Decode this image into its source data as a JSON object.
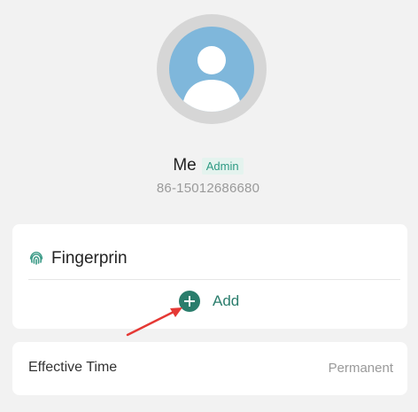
{
  "profile": {
    "name": "Me",
    "role_badge": "Admin",
    "phone": "86-15012686680"
  },
  "fingerprint": {
    "title": "Fingerprin",
    "icon": "fingerprint-icon",
    "add_label": "Add",
    "add_icon": "plus-circle-icon"
  },
  "effective_time": {
    "label": "Effective Time",
    "value": "Permanent"
  },
  "colors": {
    "accent": "#2a7d6c",
    "badge_bg": "#e4f3ee",
    "avatar_bg": "#7fb7db",
    "arrow": "#e53935"
  }
}
